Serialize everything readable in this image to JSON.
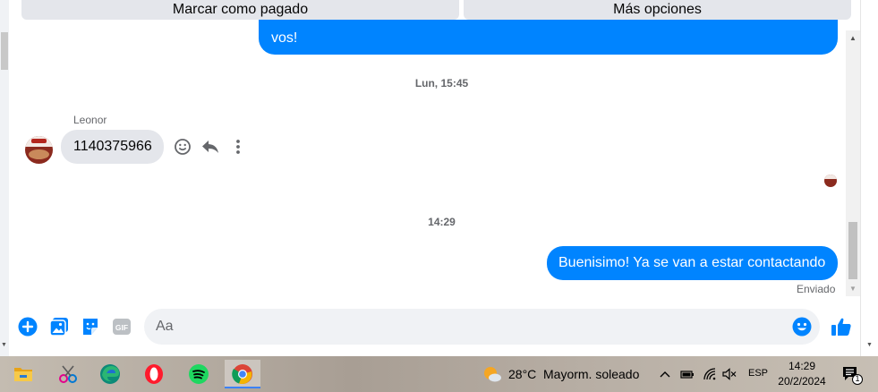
{
  "top_actions": {
    "mark_paid": "Marcar como pagado",
    "more_options": "Más opciones"
  },
  "conversation": {
    "partial_message": "vos!",
    "time_sep_1": "Lun, 15:45",
    "incoming": {
      "sender": "Leonor",
      "text": "1140375966"
    },
    "time_sep_2": "14:29",
    "last_outgoing": "Buenisimo! Ya se van a estar contactando",
    "status": "Enviado"
  },
  "composer": {
    "placeholder": "Aa"
  },
  "taskbar": {
    "weather_temp": "28°C",
    "weather_text": "Mayorm. soleado",
    "language": "ESP",
    "time": "14:29",
    "date": "20/2/2024",
    "notification_count": "1"
  },
  "colors": {
    "messenger_blue": "#0084ff",
    "bubble_gray": "#e4e6eb"
  }
}
